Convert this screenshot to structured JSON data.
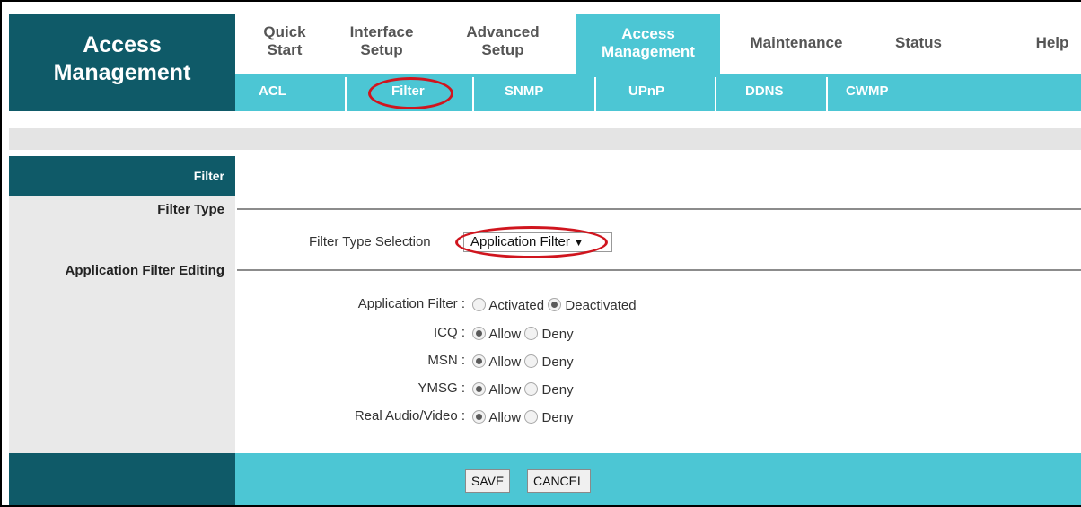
{
  "brand": {
    "line1": "Access",
    "line2": "Management"
  },
  "topnav": {
    "quick_start": [
      "Quick",
      "Start"
    ],
    "interface_setup": [
      "Interface",
      "Setup"
    ],
    "advanced_setup": [
      "Advanced",
      "Setup"
    ],
    "access_management": [
      "Access",
      "Management"
    ],
    "maintenance": "Maintenance",
    "status": "Status",
    "help": "Help"
  },
  "subnav": [
    "ACL",
    "Filter",
    "SNMP",
    "UPnP",
    "DDNS",
    "CWMP"
  ],
  "section_title": "Filter",
  "filter_type": {
    "label": "Filter Type",
    "selection_label": "Filter Type Selection",
    "selected": "Application Filter",
    "arrow": "▼"
  },
  "app_filter_editing": {
    "label": "Application Filter Editing",
    "rows": [
      {
        "label": "Application Filter :",
        "option1": "Activated",
        "option2": "Deactivated",
        "selected": "option2"
      },
      {
        "label": "ICQ :",
        "option1": "Allow",
        "option2": "Deny",
        "selected": "option1"
      },
      {
        "label": "MSN :",
        "option1": "Allow",
        "option2": "Deny",
        "selected": "option1"
      },
      {
        "label": "YMSG :",
        "option1": "Allow",
        "option2": "Deny",
        "selected": "option1"
      },
      {
        "label": "Real Audio/Video :",
        "option1": "Allow",
        "option2": "Deny",
        "selected": "option1"
      }
    ]
  },
  "buttons": {
    "save": "SAVE",
    "cancel": "CANCEL"
  },
  "colors": {
    "dark_teal": "#0f5a68",
    "light_teal": "#4cc6d4",
    "highlight_red": "#d0151e"
  }
}
